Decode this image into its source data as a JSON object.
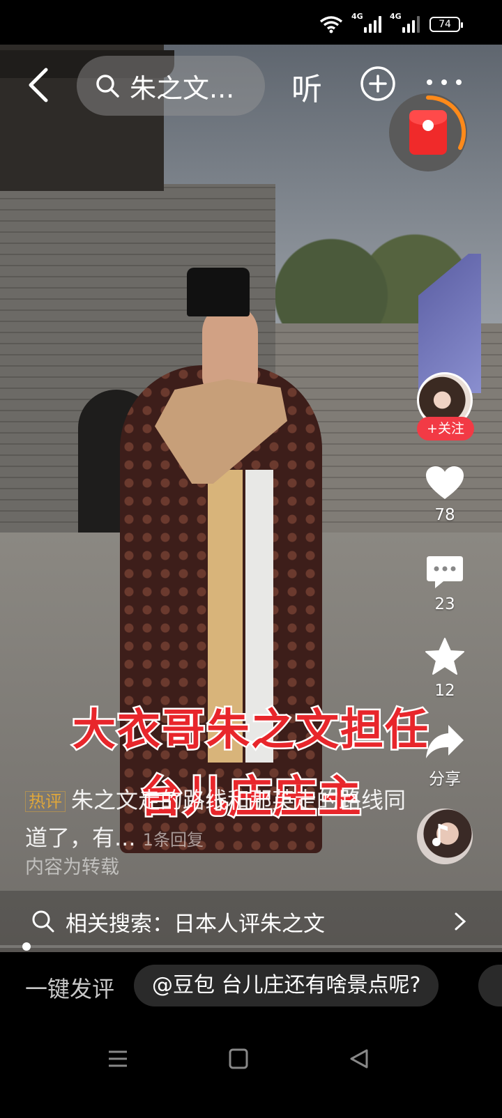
{
  "status_bar": {
    "net1": "4G",
    "net2": "4G",
    "battery": "74"
  },
  "top_nav": {
    "search_text": "朱之文...",
    "listen": "听"
  },
  "video": {
    "title_line1": "大衣哥朱之文担任",
    "title_line2": "台儿庄庄主"
  },
  "side_rail": {
    "follow_label": "+关注",
    "likes": "78",
    "comments": "23",
    "favorites": "12",
    "share_label": "分享"
  },
  "hot_comment": {
    "tag": "热评",
    "text": "朱之文走的路线和那英走的路线同道了，有...",
    "reply_count": "1条回复"
  },
  "repost_notice": "内容为转载",
  "related_search": {
    "label": "相关搜索：日本人评朱之文"
  },
  "bottom": {
    "quick_comment_label": "一键发评",
    "suggestion_chip": "@豆包 台儿庄还有啥景点呢?"
  },
  "icons": {
    "back": "back-arrow-icon",
    "search": "search-icon",
    "add": "plus-circle-icon",
    "more": "more-dots-icon",
    "like": "heart-icon",
    "comment": "comment-icon",
    "favorite": "star-icon",
    "share": "share-arrow-icon"
  },
  "colors": {
    "follow": "#f23a45",
    "title_red": "#e8262b",
    "hot_tag": "#e0a73a",
    "redpack": "#f02a2a"
  }
}
